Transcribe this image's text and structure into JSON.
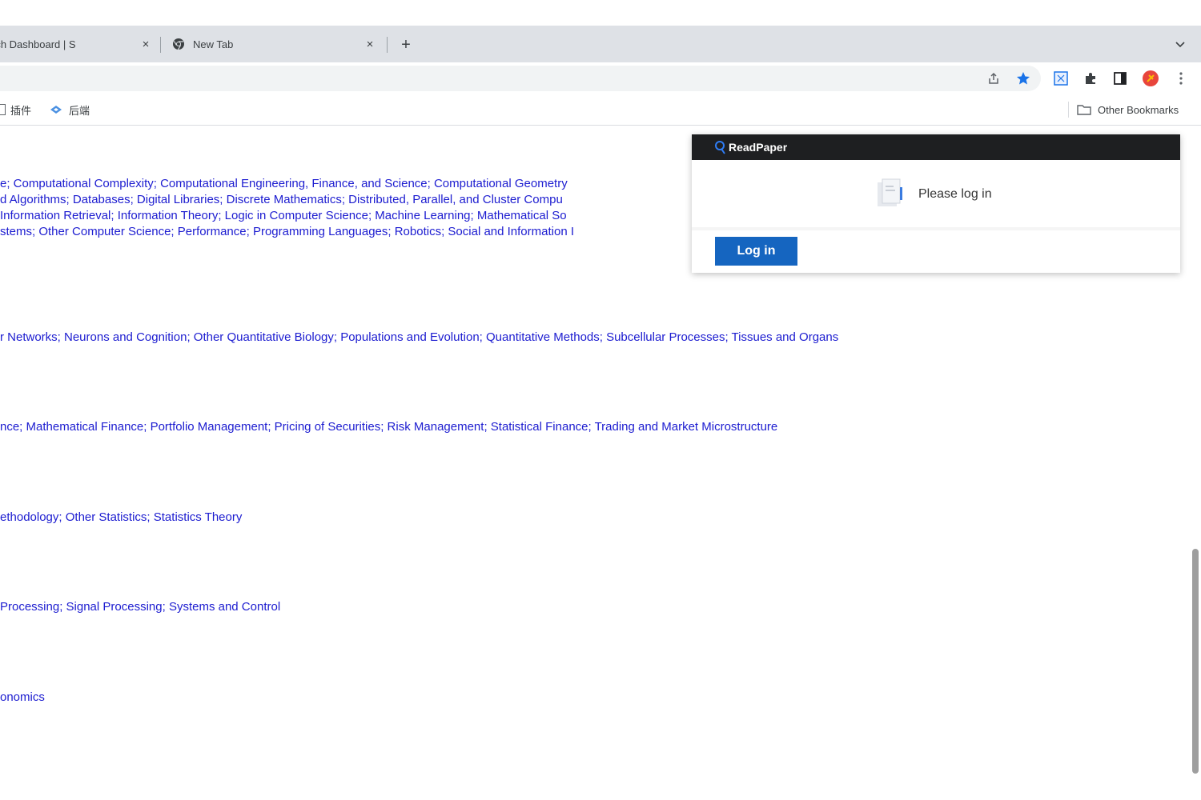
{
  "browser": {
    "tabs": [
      {
        "title": "rch Dashboard | S",
        "close_label": "×"
      },
      {
        "title": "New Tab",
        "close_label": "×"
      }
    ],
    "new_tab_label": "+",
    "toolbar_icons": [
      "share-icon",
      "star-icon",
      "extension-readpaper-icon",
      "puzzle-icon",
      "side-panel-icon",
      "profile-avatar-icon",
      "kebab-menu-icon"
    ],
    "bookmarks": [
      {
        "label": "插件"
      },
      {
        "label": "后端"
      }
    ],
    "other_bookmarks": "Other Bookmarks"
  },
  "page": {
    "subject_lines": [
      "e; Computational Complexity; Computational Engineering, Finance, and Science; Computational Geometry",
      "d Algorithms; Databases; Digital Libraries; Discrete Mathematics; Distributed, Parallel, and Cluster Compu",
      "Information Retrieval; Information Theory; Logic in Computer Science; Machine Learning; Mathematical So",
      "stems; Other Computer Science; Performance; Programming Languages; Robotics; Social and Information I",
      "r Networks; Neurons and Cognition; Other Quantitative Biology; Populations and Evolution; Quantitative Methods; Subcellular Processes; Tissues and Organs",
      "nce; Mathematical Finance; Portfolio Management; Pricing of Securities; Risk Management; Statistical Finance; Trading and Market Microstructure",
      "ethodology; Other Statistics; Statistics Theory",
      "Processing; Signal Processing; Systems and Control",
      "onomics"
    ]
  },
  "readpaper_popup": {
    "brand": "ReadPaper",
    "message": "Please log in",
    "login_button": "Log in"
  },
  "colors": {
    "link": "#1c1cd0",
    "tab_strip": "#dee1e6",
    "popup_header": "#1e1f21",
    "login_button": "#1565c0",
    "star": "#1a73e8"
  }
}
